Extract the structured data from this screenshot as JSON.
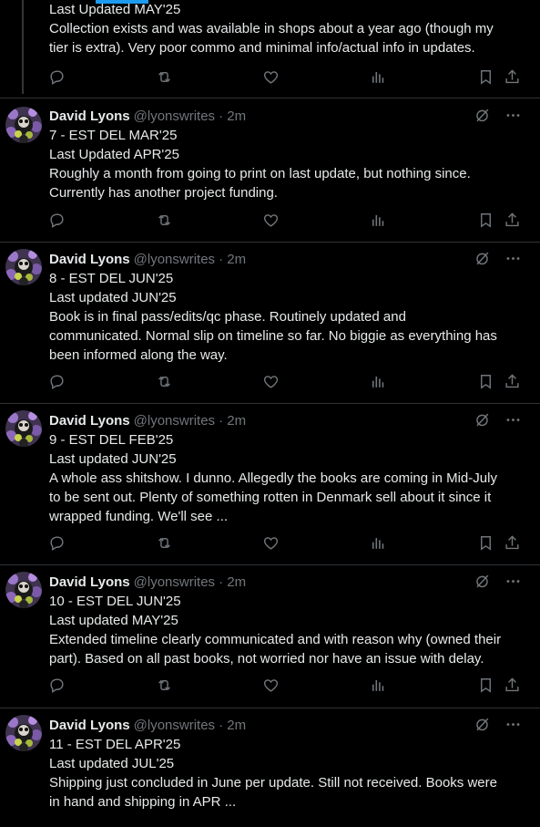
{
  "tabs": {
    "active_accent": "#1d9bf0"
  },
  "top_partial": {
    "lines": [
      "Last Updated MAY'25",
      "Collection exists and was available in shops about a year ago (though my",
      "tier is extra). Very poor commo and minimal info/actual info in updates."
    ]
  },
  "tweets": [
    {
      "name": "David Lyons",
      "handle": "@lyonswrites",
      "time": "· 2m",
      "lines": [
        "7 - EST DEL MAR'25",
        "Last Updated APR'25",
        "Roughly a month from going to print on last update, but nothing since.",
        "Currently has another project funding."
      ]
    },
    {
      "name": "David Lyons",
      "handle": "@lyonswrites",
      "time": "· 2m",
      "lines": [
        "8 - EST DEL JUN'25",
        "Last updated JUN'25",
        "Book is in final pass/edits/qc phase. Routinely updated and",
        "communicated. Normal slip on timeline so far. No biggie as everything has",
        "been informed along the way."
      ]
    },
    {
      "name": "David Lyons",
      "handle": "@lyonswrites",
      "time": "· 2m",
      "lines": [
        "9 - EST DEL FEB'25",
        "Last updated JUN'25",
        "A whole ass shitshow. I dunno. Allegedly the books are coming in Mid-July",
        "to be sent out. Plenty of something rotten in Denmark sell about it since it",
        "wrapped funding. We'll see ..."
      ]
    },
    {
      "name": "David Lyons",
      "handle": "@lyonswrites",
      "time": "· 2m",
      "lines": [
        "10 - EST DEL JUN'25",
        "Last updated MAY'25",
        "Extended timeline clearly communicated and with reason why (owned their",
        "part). Based on all past books, not worried nor have an issue with delay."
      ]
    },
    {
      "name": "David Lyons",
      "handle": "@lyonswrites",
      "time": "· 2m",
      "lines": [
        "11 - EST DEL APR'25",
        "Last updated JUL'25",
        "Shipping just concluded in June per update. Still not received. Books were",
        "in hand and shipping in APR ..."
      ]
    }
  ],
  "icons": [
    "reply-icon",
    "retweet-icon",
    "like-icon",
    "views-icon",
    "bookmark-icon",
    "share-icon",
    "grok-icon",
    "more-icon"
  ]
}
